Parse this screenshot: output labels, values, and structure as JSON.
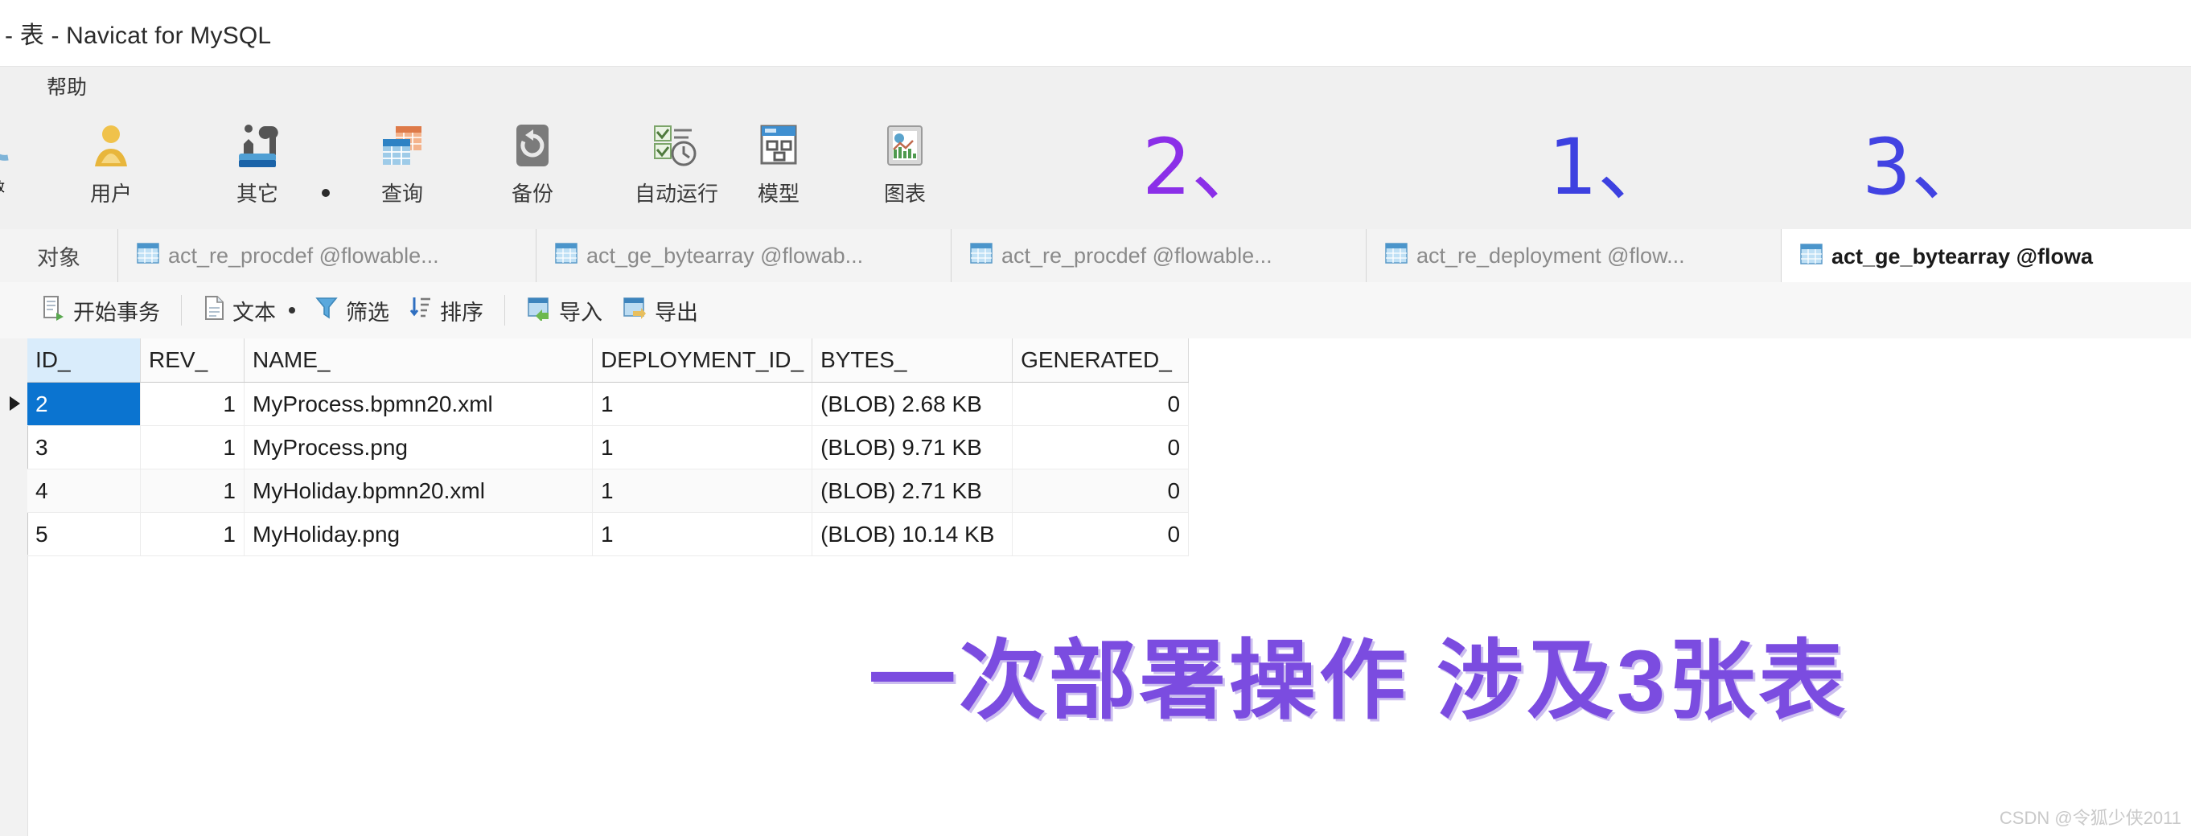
{
  "window": {
    "title": "- 表 - Navicat for MySQL"
  },
  "menubar": {
    "items": [
      {
        "label": "帮助",
        "name": "menu-help"
      }
    ]
  },
  "ribbon": {
    "clipped_left_label": "改",
    "buttons": [
      {
        "label": "用户",
        "icon": "user-icon"
      },
      {
        "label": "其它",
        "icon": "tools-icon"
      },
      {
        "label": "查询",
        "icon": "query-icon"
      },
      {
        "label": "备份",
        "icon": "backup-icon"
      },
      {
        "label": "自动运行",
        "icon": "automation-icon"
      },
      {
        "label": "模型",
        "icon": "model-icon"
      },
      {
        "label": "图表",
        "icon": "chart-icon"
      }
    ]
  },
  "annotations": [
    {
      "text": "2、",
      "color": "#8b2fe8"
    },
    {
      "text": "1、",
      "color": "#3d41e0"
    },
    {
      "text": "3、",
      "color": "#4243e2"
    }
  ],
  "tabs": [
    {
      "label": "对象",
      "icon": "",
      "active": false
    },
    {
      "label": "act_re_procdef @flowable...",
      "icon": "table-icon",
      "active": false
    },
    {
      "label": "act_ge_bytearray @flowab...",
      "icon": "table-icon",
      "active": false
    },
    {
      "label": "act_re_procdef @flowable...",
      "icon": "table-icon",
      "active": false
    },
    {
      "label": "act_re_deployment @flow...",
      "icon": "table-icon",
      "active": false
    },
    {
      "label": "act_ge_bytearray @flowa",
      "icon": "table-icon",
      "active": true
    }
  ],
  "subtoolbar": {
    "buttons": [
      {
        "label": "开始事务",
        "icon": "transaction-icon"
      },
      {
        "label": "文本",
        "icon": "text-icon"
      },
      {
        "label": "筛选",
        "icon": "filter-icon"
      },
      {
        "label": "排序",
        "icon": "sort-icon"
      },
      {
        "label": "导入",
        "icon": "import-icon"
      },
      {
        "label": "导出",
        "icon": "export-icon"
      }
    ]
  },
  "grid": {
    "columns": [
      "ID_",
      "REV_",
      "NAME_",
      "DEPLOYMENT_ID_",
      "BYTES_",
      "GENERATED_"
    ],
    "selected_cell": {
      "row": 0,
      "column": 0
    },
    "rows": [
      {
        "ID_": "2",
        "REV_": "1",
        "NAME_": "MyProcess.bpmn20.xml",
        "DEPLOYMENT_ID_": "1",
        "BYTES_": "(BLOB) 2.68 KB",
        "GENERATED_": "0"
      },
      {
        "ID_": "3",
        "REV_": "1",
        "NAME_": "MyProcess.png",
        "DEPLOYMENT_ID_": "1",
        "BYTES_": "(BLOB) 9.71 KB",
        "GENERATED_": "0"
      },
      {
        "ID_": "4",
        "REV_": "1",
        "NAME_": "MyHoliday.bpmn20.xml",
        "DEPLOYMENT_ID_": "1",
        "BYTES_": "(BLOB) 2.71 KB",
        "GENERATED_": "0"
      },
      {
        "ID_": "5",
        "REV_": "1",
        "NAME_": "MyHoliday.png",
        "DEPLOYMENT_ID_": "1",
        "BYTES_": "(BLOB) 10.14 KB",
        "GENERATED_": "0"
      }
    ]
  },
  "caption": {
    "text": "一次部署操作 涉及3张表",
    "color": "#7b4ce0"
  },
  "watermark": {
    "text": "CSDN @令狐少侠2011"
  }
}
